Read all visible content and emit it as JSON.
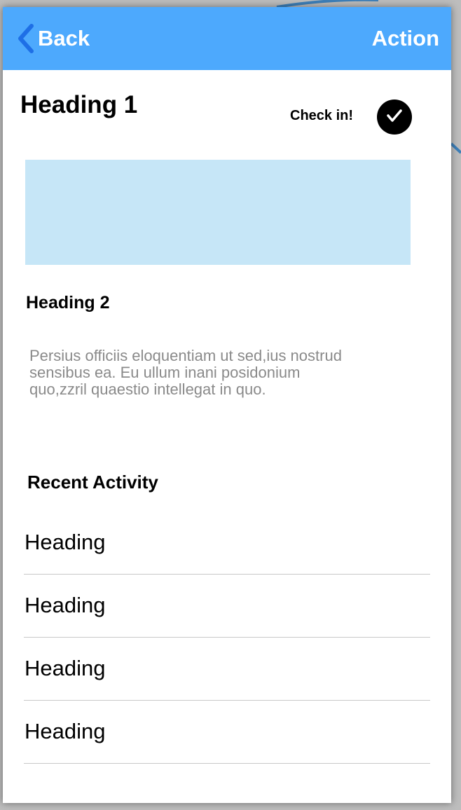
{
  "navbar": {
    "back_label": "Back",
    "action_label": "Action",
    "background_color": "#4da9fd",
    "back_icon": "chevron-left-icon"
  },
  "header": {
    "title": "Heading 1",
    "checkin_label": "Check in!",
    "checkin_icon": "checkmark-icon"
  },
  "content": {
    "image_placeholder_color": "#c6e6f7",
    "subheading": "Heading 2",
    "paragraph": "Persius officiis eloquentiam ut sed,ius nostrud sensibus ea. Eu ullum inani posidonium quo,zzril quaestio intellegat in quo."
  },
  "recent_activity": {
    "title": "Recent Activity",
    "items": [
      {
        "label": "Heading"
      },
      {
        "label": "Heading"
      },
      {
        "label": "Heading"
      },
      {
        "label": "Heading"
      }
    ]
  }
}
